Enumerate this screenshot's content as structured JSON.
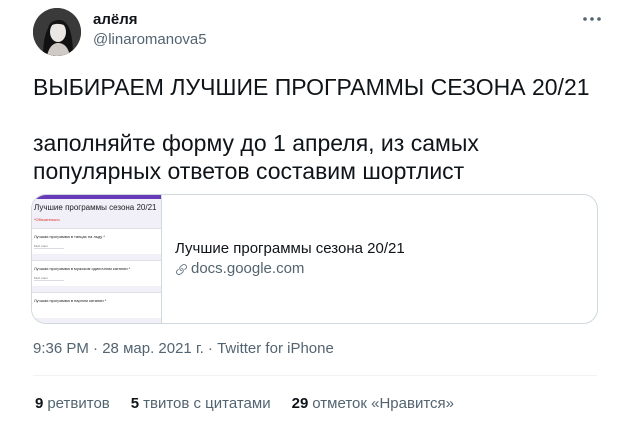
{
  "author": {
    "display_name": "алёля",
    "handle": "@linaromanova5",
    "avatar_icon": "user-avatar"
  },
  "tweet": {
    "line1": "ВЫБИРАЕМ ЛУЧШИЕ ПРОГРАММЫ СЕЗОНА 20/21",
    "line2": "заполняйте форму до 1 апреля, из самых",
    "line3": "популярных ответов составим шортлист"
  },
  "link_card": {
    "title": "Лучшие программы сезона 20/21",
    "domain": "docs.google.com",
    "link_icon": "link-icon",
    "thumbnail": {
      "form_title": "Лучшие программы сезона 20/21",
      "required_note": "*Обязательно",
      "fields": [
        {
          "question": "Лучшая программа в танцах на льду *",
          "answer": "Мой ответ"
        },
        {
          "question": "Лучшая программа в мужском одиночном катании *",
          "answer": "Мой ответ"
        },
        {
          "question": "Лучшая программа в парном катании *",
          "answer": ""
        }
      ]
    }
  },
  "meta": {
    "time": "9:36 PM",
    "sep": "·",
    "date": "28 мар. 2021 г.",
    "source": "Twitter for iPhone"
  },
  "stats": {
    "retweets_count": "9",
    "retweets_label": "ретвитов",
    "quotes_count": "5",
    "quotes_label": "твитов с цитатами",
    "likes_count": "29",
    "likes_label": "отметок «Нравится»"
  },
  "colors": {
    "text": "#0f1419",
    "secondary": "#536471",
    "border": "#cfd9de",
    "form_accent": "#673ab7"
  },
  "icons": {
    "more": "more-horizontal-icon",
    "link": "link-icon"
  }
}
